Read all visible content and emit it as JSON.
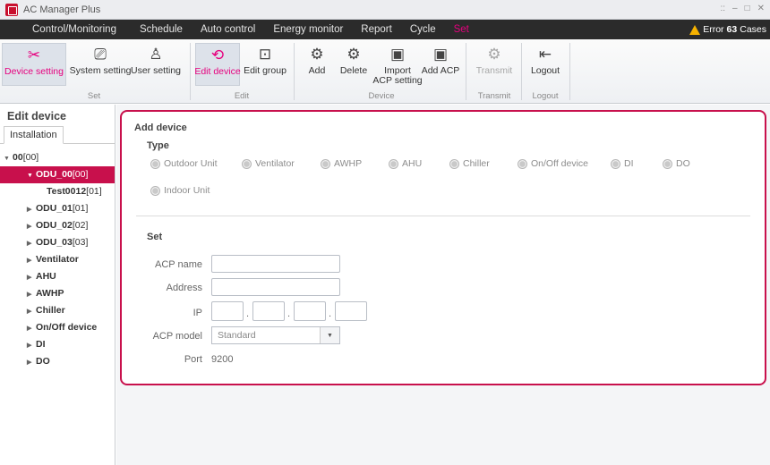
{
  "app": {
    "title": "AC Manager Plus",
    "window_controls": [
      "::",
      "–",
      "□",
      "✕"
    ]
  },
  "menu": {
    "items": [
      "Control/Monitoring",
      "Schedule",
      "Auto control",
      "Energy monitor",
      "Report",
      "Cycle",
      "Set"
    ],
    "active": "Set",
    "error": {
      "label": "Error",
      "count": "63",
      "unit": "Cases"
    }
  },
  "ribbon": {
    "groups": {
      "set": "Set",
      "edit": "Edit",
      "device": "Device",
      "transmit": "Transmit",
      "logout": "Logout"
    },
    "buttons": {
      "device_setting": "Device setting",
      "system_setting": "System setting",
      "user_setting": "User setting",
      "edit_device": "Edit device",
      "edit_group": "Edit group",
      "add": "Add",
      "delete": "Delete",
      "import_acp_1": "Import",
      "import_acp_2": "ACP setting",
      "add_acp": "Add ACP",
      "transmit": "Transmit",
      "logout": "Logout"
    }
  },
  "left": {
    "title": "Edit device",
    "tab": "Installation",
    "tree": [
      {
        "name": "00",
        "num": "[00]"
      },
      {
        "name": "ODU_00",
        "num": "[00]"
      },
      {
        "name": "Test0012",
        "num": "[01]"
      },
      {
        "name": "ODU_01",
        "num": "[01]"
      },
      {
        "name": "ODU_02",
        "num": "[02]"
      },
      {
        "name": "ODU_03",
        "num": "[03]"
      },
      {
        "name": "Ventilator",
        "num": ""
      },
      {
        "name": "AHU",
        "num": ""
      },
      {
        "name": "AWHP",
        "num": ""
      },
      {
        "name": "Chiller",
        "num": ""
      },
      {
        "name": "On/Off device",
        "num": ""
      },
      {
        "name": "DI",
        "num": ""
      },
      {
        "name": "DO",
        "num": ""
      }
    ]
  },
  "form": {
    "add_device_title": "Add device",
    "type_label": "Type",
    "types": [
      "Outdoor Unit",
      "Ventilator",
      "AWHP",
      "AHU",
      "Chiller",
      "On/Off device",
      "DI",
      "DO",
      "Indoor Unit"
    ],
    "set_title": "Set",
    "acp_name_label": "ACP name",
    "acp_name_value": "",
    "address_label": "Address",
    "address_value": "",
    "ip_label": "IP",
    "ip_values": [
      "",
      "",
      "",
      ""
    ],
    "acp_model_label": "ACP model",
    "acp_model_value": "Standard",
    "port_label": "Port",
    "port_value": "9200"
  },
  "colors": {
    "accent": "#c8104c",
    "menu_bg": "#2b2b2b",
    "active_menu": "#e6007e",
    "warning": "#f6b200"
  }
}
